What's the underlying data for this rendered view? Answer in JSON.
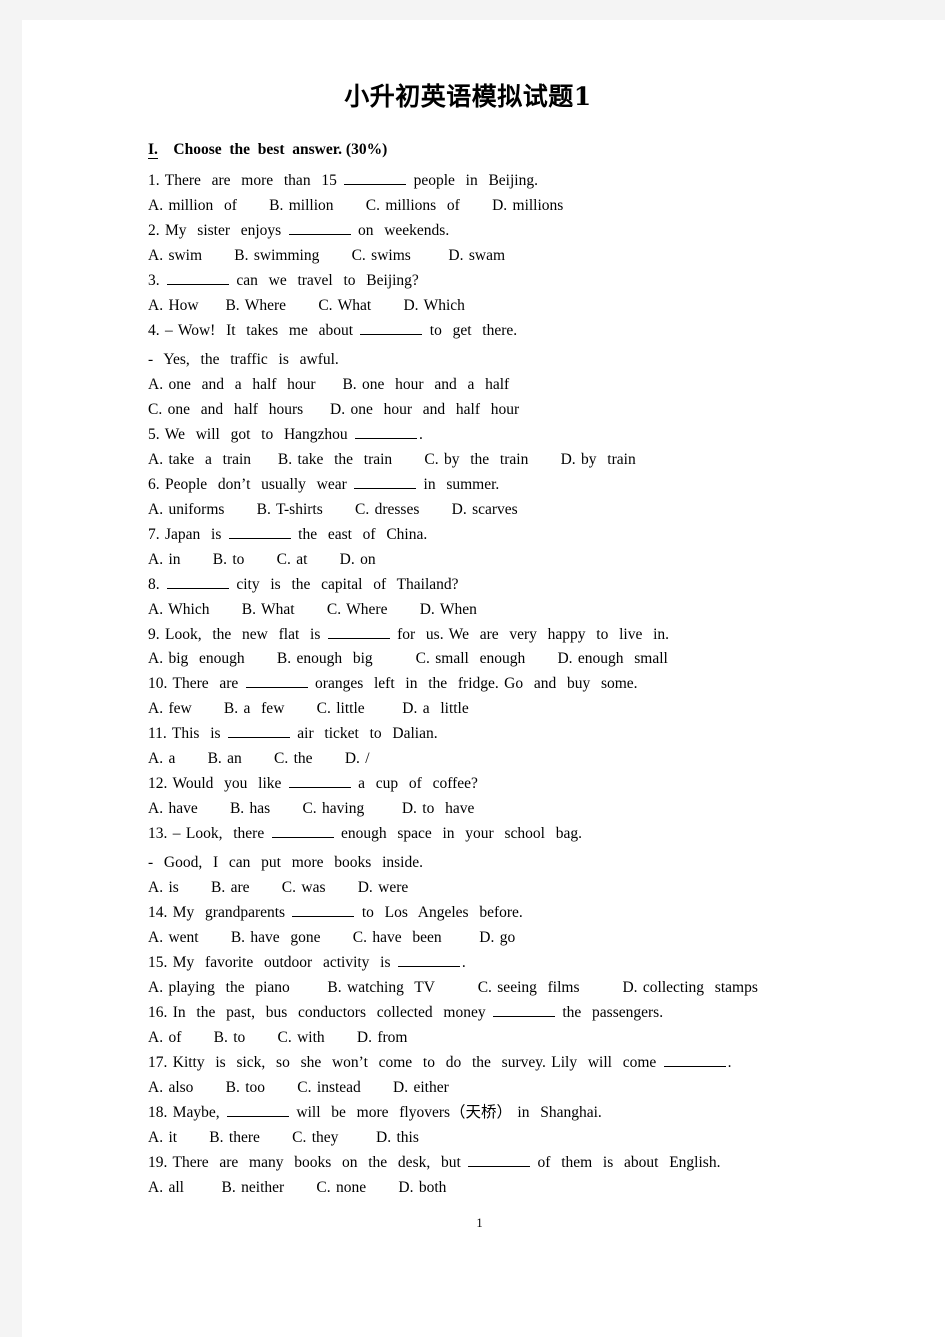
{
  "document": {
    "title": "小升初英语模拟试题1",
    "page_number": "1",
    "section": {
      "number": "I.",
      "heading": "Choose  the  best  answer. (30%)"
    },
    "lines": [
      {
        "id": "q1",
        "text": "1. There  are  more  than  15 ",
        "blank": true,
        "after": " people  in  Beijing."
      },
      {
        "id": "q1o",
        "text": "A. million  of      B. million      C. millions  of      D. millions"
      },
      {
        "id": "q2",
        "text": "2. My  sister  enjoys ",
        "blank": true,
        "after": " on  weekends."
      },
      {
        "id": "q2o",
        "text": "A. swim      B. swimming      C. swims       D. swam"
      },
      {
        "id": "q3",
        "text": "3. ",
        "blank": true,
        "after": " can  we  travel  to  Beijing?"
      },
      {
        "id": "q3o",
        "text": "A. How     B. Where      C. What      D. Which"
      },
      {
        "id": "q4",
        "text": "4. – Wow!  It  takes  me  about ",
        "blank": true,
        "after": " to  get  there."
      },
      {
        "id": "q4b",
        "text": "-  Yes,  the  traffic  is  awful.",
        "dashlead": true
      },
      {
        "id": "q4o1",
        "text": "A. one  and  a  half  hour     B. one  hour  and  a  half"
      },
      {
        "id": "q4o2",
        "text": "C. one  and  half  hours     D. one  hour  and  half  hour"
      },
      {
        "id": "q5",
        "text": "5. We  will  got  to  Hangzhou ",
        "blank": true,
        "after": "."
      },
      {
        "id": "q5o",
        "text": "A. take  a  train     B. take  the  train      C. by  the  train      D. by  train"
      },
      {
        "id": "q6",
        "text": "6. People  don’t  usually  wear ",
        "blank": true,
        "after": " in  summer."
      },
      {
        "id": "q6o",
        "text": "A. uniforms      B. T-shirts      C. dresses      D. scarves"
      },
      {
        "id": "q7",
        "text": "7. Japan  is ",
        "blank": true,
        "after": " the  east  of  China."
      },
      {
        "id": "q7o",
        "text": "A. in      B. to      C. at      D. on"
      },
      {
        "id": "q8",
        "text": "8. ",
        "blank": true,
        "after": " city  is  the  capital  of  Thailand?"
      },
      {
        "id": "q8o",
        "text": "A. Which      B. What      C. Where      D. When"
      },
      {
        "id": "q9",
        "text": "9. Look,  the  new  flat  is ",
        "blank": true,
        "after": " for  us. We  are  very  happy  to  live  in."
      },
      {
        "id": "q9o",
        "text": "A. big  enough      B. enough  big        C. small  enough      D. enough  small"
      },
      {
        "id": "q10",
        "text": "10. There  are ",
        "blank": true,
        "after": " oranges  left  in  the  fridge. Go  and  buy  some."
      },
      {
        "id": "q10o",
        "text": "A. few      B. a  few      C. little       D. a  little"
      },
      {
        "id": "q11",
        "text": "11. This  is ",
        "blank": true,
        "after": " air  ticket  to  Dalian."
      },
      {
        "id": "q11o",
        "text": "A. a      B. an      C. the      D. /"
      },
      {
        "id": "q12",
        "text": "12. Would  you  like ",
        "blank": true,
        "after": " a  cup  of  coffee?"
      },
      {
        "id": "q12o",
        "text": "A. have      B. has      C. having       D. to  have"
      },
      {
        "id": "q13",
        "text": "13. – Look,  there ",
        "blank": true,
        "after": " enough  space  in  your  school  bag."
      },
      {
        "id": "q13b",
        "text": "-  Good,  I  can  put  more  books  inside.",
        "dashlead": true
      },
      {
        "id": "q13o",
        "text": "A. is      B. are      C. was      D. were"
      },
      {
        "id": "q14",
        "text": "14. My  grandparents ",
        "blank": true,
        "after": " to  Los  Angeles  before."
      },
      {
        "id": "q14o",
        "text": "A. went      B. have  gone      C. have  been       D. go"
      },
      {
        "id": "q15",
        "text": "15. My  favorite  outdoor  activity  is ",
        "blank": true,
        "after": "."
      },
      {
        "id": "q15o",
        "text": "A. playing  the  piano       B. watching  TV        C. seeing  films        D. collecting  stamps"
      },
      {
        "id": "q16",
        "text": "16. In  the  past,  bus  conductors  collected  money ",
        "blank": true,
        "after": " the  passengers."
      },
      {
        "id": "q16o",
        "text": "A. of      B. to      C. with      D. from"
      },
      {
        "id": "q17",
        "text": "17. Kitty  is  sick,  so  she  won’t  come  to  do  the  survey. Lily  will  come ",
        "blank": true,
        "after": "."
      },
      {
        "id": "q17o",
        "text": "A. also      B. too      C. instead      D. either"
      },
      {
        "id": "q18",
        "text": "18. Maybe, ",
        "blank": true,
        "after": " will  be  more  flyovers（天桥） in  Shanghai."
      },
      {
        "id": "q18o",
        "text": "A. it      B. there      C. they       D. this"
      },
      {
        "id": "q19",
        "text": "19. There  are  many  books  on  the  desk,  but ",
        "blank": true,
        "after": " of  them  is  about  English."
      },
      {
        "id": "q19o",
        "text": "A. all       B. neither      C. none      D. both"
      }
    ]
  }
}
